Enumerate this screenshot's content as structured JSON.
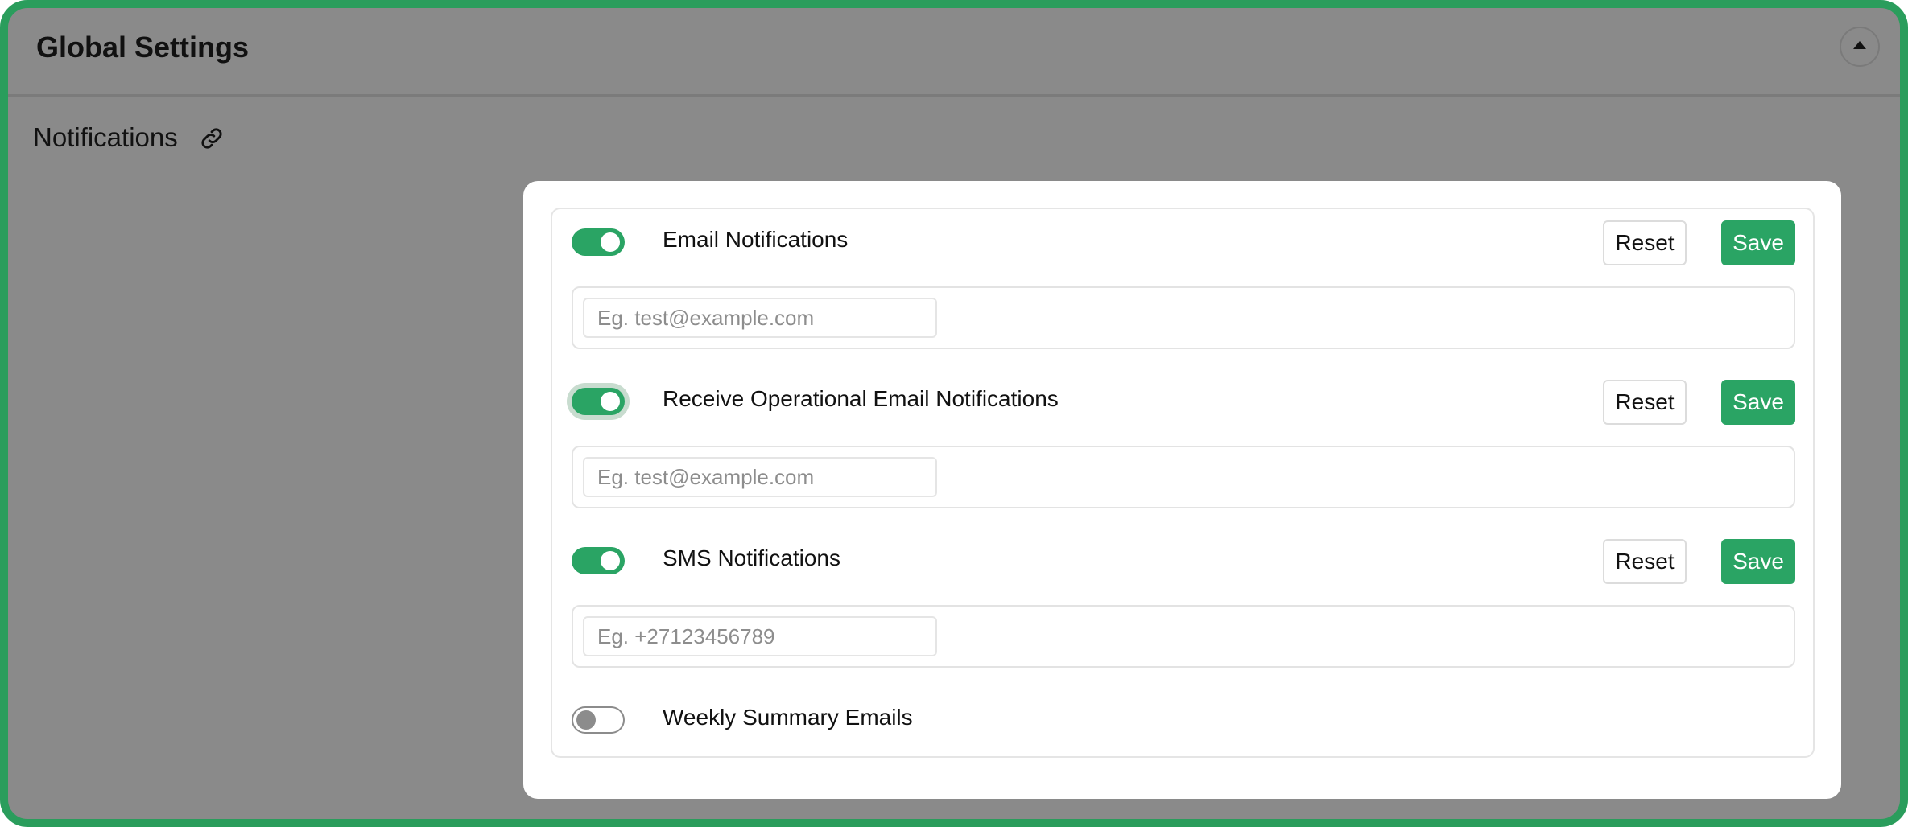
{
  "header": {
    "title": "Global Settings"
  },
  "section": {
    "label": "Notifications"
  },
  "settings": [
    {
      "label": "Email Notifications",
      "enabled": true,
      "placeholder": "Eg. test@example.com",
      "reset": "Reset",
      "save": "Save"
    },
    {
      "label": "Receive Operational Email Notifications",
      "enabled": true,
      "placeholder": "Eg. test@example.com",
      "reset": "Reset",
      "save": "Save"
    },
    {
      "label": "SMS Notifications",
      "enabled": true,
      "placeholder": "Eg. +27123456789",
      "reset": "Reset",
      "save": "Save"
    },
    {
      "label": "Weekly Summary Emails",
      "enabled": false
    }
  ],
  "colors": {
    "accent": "#2aa464",
    "border": "#2a9d5c",
    "overlay": "#8a8a8a"
  },
  "icons": {
    "collapse": "caret-up-icon",
    "link": "link-icon"
  }
}
